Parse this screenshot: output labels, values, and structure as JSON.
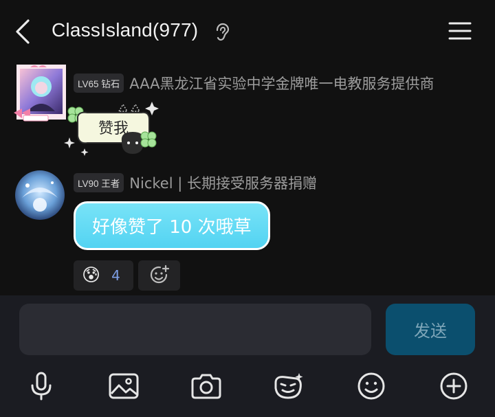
{
  "header": {
    "title": "ClassIsland(977)",
    "back_icon": "chevron-left-icon",
    "ear_icon": "ear-icon",
    "menu_icon": "hamburger-menu-icon"
  },
  "messages": [
    {
      "level": "LV65 钻石",
      "sender": "AAA黑龙江省实验中学金牌唯一电教服务提供商",
      "sticker_text": "赞我"
    },
    {
      "level": "LV90 王者",
      "sender": "Nickel | 长期接受服务器捐赠",
      "text": "好像赞了 10 次哦草",
      "reactions": [
        {
          "emoji": "😰",
          "count": "4"
        }
      ]
    }
  ],
  "composer": {
    "placeholder": "",
    "send_label": "发送"
  },
  "toolbar": [
    "microphone-icon",
    "image-icon",
    "camera-icon",
    "sticker-icon",
    "emoji-icon",
    "add-icon"
  ],
  "colors": {
    "background": "#111111",
    "bubble": "#5cd6f3",
    "send_button": "#0b4f6e",
    "composer_bg": "#1b1c22"
  }
}
